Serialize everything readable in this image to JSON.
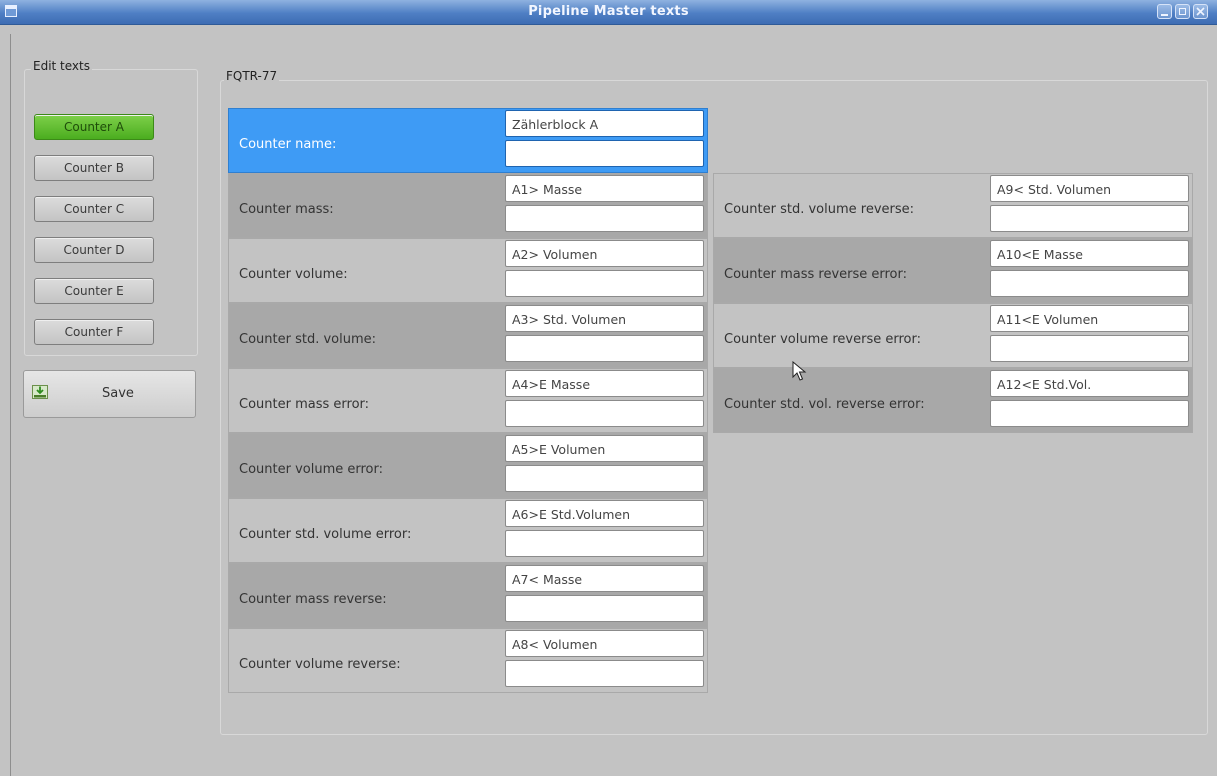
{
  "window": {
    "title": "Pipeline Master texts"
  },
  "sidebar": {
    "group_title": "Edit texts",
    "counters": [
      {
        "label": "Counter A",
        "active": true
      },
      {
        "label": "Counter B",
        "active": false
      },
      {
        "label": "Counter C",
        "active": false
      },
      {
        "label": "Counter D",
        "active": false
      },
      {
        "label": "Counter E",
        "active": false
      },
      {
        "label": "Counter F",
        "active": false
      }
    ],
    "save_label": "Save"
  },
  "main": {
    "group_title": "FQTR-77",
    "left_rows": [
      {
        "label": "Counter name:",
        "value1": "Zählerblock A",
        "value2": ""
      },
      {
        "label": "Counter mass:",
        "value1": "A1> Masse",
        "value2": ""
      },
      {
        "label": "Counter volume:",
        "value1": "A2> Volumen",
        "value2": ""
      },
      {
        "label": "Counter std. volume:",
        "value1": "A3> Std. Volumen",
        "value2": ""
      },
      {
        "label": "Counter mass error:",
        "value1": "A4>E Masse",
        "value2": ""
      },
      {
        "label": "Counter volume error:",
        "value1": "A5>E Volumen",
        "value2": ""
      },
      {
        "label": "Counter std. volume error:",
        "value1": "A6>E Std.Volumen",
        "value2": ""
      },
      {
        "label": "Counter mass reverse:",
        "value1": "A7< Masse",
        "value2": ""
      },
      {
        "label": "Counter volume reverse:",
        "value1": "A8< Volumen",
        "value2": ""
      }
    ],
    "right_rows": [
      {
        "label": "Counter std. volume reverse:",
        "value1": "A9< Std. Volumen",
        "value2": ""
      },
      {
        "label": "Counter mass reverse error:",
        "value1": "A10<E Masse",
        "value2": ""
      },
      {
        "label": "Counter volume reverse error:",
        "value1": "A11<E Volumen",
        "value2": ""
      },
      {
        "label": "Counter std. vol. reverse error:",
        "value1": "A12<E Std.Vol.",
        "value2": ""
      }
    ]
  },
  "colors": {
    "selected_row": "#3e9bf5",
    "active_counter": "#5bbf2a",
    "title_bar": "#4f7fc4"
  }
}
